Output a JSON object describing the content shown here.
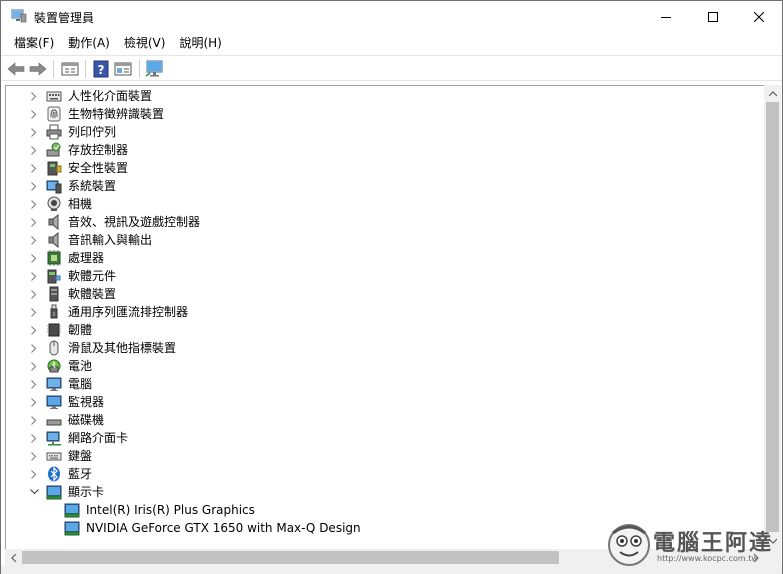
{
  "window": {
    "title": "裝置管理員",
    "minimize_icon": "minimize-icon",
    "maximize_icon": "maximize-icon",
    "close_icon": "close-icon"
  },
  "menu": [
    {
      "label": "檔案(F)"
    },
    {
      "label": "動作(A)"
    },
    {
      "label": "檢視(V)"
    },
    {
      "label": "說明(H)"
    }
  ],
  "toolbar": {
    "buttons": [
      "back-arrow-icon",
      "forward-arrow-icon",
      "properties-icon",
      "help-icon",
      "view-icon",
      "monitor-scan-icon"
    ]
  },
  "tree": {
    "items": [
      {
        "label": "人性化介面裝置",
        "icon": "hid-icon",
        "expanded": false
      },
      {
        "label": "生物特徵辨識裝置",
        "icon": "fingerprint-icon",
        "expanded": false
      },
      {
        "label": "列印佇列",
        "icon": "printer-icon",
        "expanded": false
      },
      {
        "label": "存放控制器",
        "icon": "storage-controller-icon",
        "expanded": false
      },
      {
        "label": "安全性裝置",
        "icon": "security-device-icon",
        "expanded": false
      },
      {
        "label": "系統裝置",
        "icon": "system-device-icon",
        "expanded": false
      },
      {
        "label": "相機",
        "icon": "camera-icon",
        "expanded": false
      },
      {
        "label": "音效、視訊及遊戲控制器",
        "icon": "speaker-icon",
        "expanded": false
      },
      {
        "label": "音訊輸入與輸出",
        "icon": "speaker-icon",
        "expanded": false
      },
      {
        "label": "處理器",
        "icon": "processor-icon",
        "expanded": false
      },
      {
        "label": "軟體元件",
        "icon": "software-component-icon",
        "expanded": false
      },
      {
        "label": "軟體裝置",
        "icon": "software-device-icon",
        "expanded": false
      },
      {
        "label": "通用序列匯流排控制器",
        "icon": "usb-icon",
        "expanded": false
      },
      {
        "label": "韌體",
        "icon": "firmware-icon",
        "expanded": false
      },
      {
        "label": "滑鼠及其他指標裝置",
        "icon": "mouse-icon",
        "expanded": false
      },
      {
        "label": "電池",
        "icon": "battery-icon",
        "expanded": false
      },
      {
        "label": "電腦",
        "icon": "computer-icon",
        "expanded": false
      },
      {
        "label": "監視器",
        "icon": "monitor-icon",
        "expanded": false
      },
      {
        "label": "磁碟機",
        "icon": "disk-drive-icon",
        "expanded": false
      },
      {
        "label": "網路介面卡",
        "icon": "network-adapter-icon",
        "expanded": false
      },
      {
        "label": "鍵盤",
        "icon": "keyboard-icon",
        "expanded": false
      },
      {
        "label": "藍牙",
        "icon": "bluetooth-icon",
        "expanded": false
      },
      {
        "label": "顯示卡",
        "icon": "display-adapter-icon",
        "expanded": true
      }
    ],
    "children": [
      {
        "label": "Intel(R) Iris(R) Plus Graphics",
        "icon": "display-adapter-icon"
      },
      {
        "label": "NVIDIA GeForce GTX 1650 with Max-Q Design",
        "icon": "display-adapter-icon"
      }
    ]
  },
  "watermark": {
    "text": "電腦王阿達",
    "url": "http://www.kocpc.com.tw"
  }
}
